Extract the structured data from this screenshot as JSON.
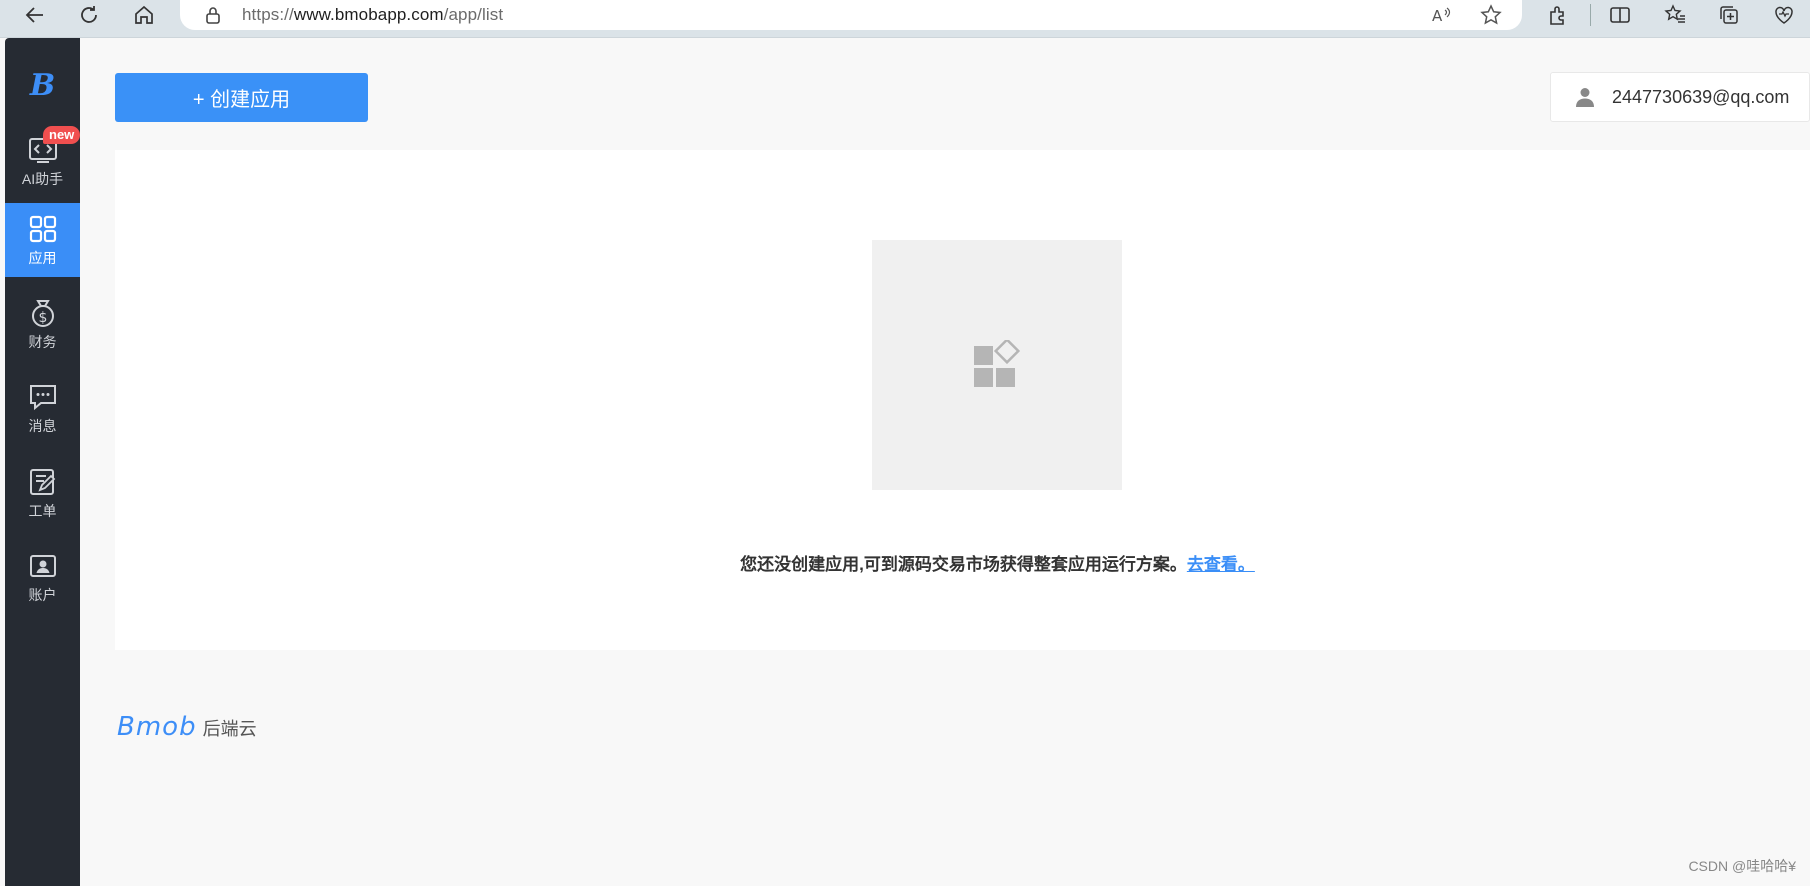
{
  "browser": {
    "url_scheme": "https://",
    "url_host": "www.bmobapp.com",
    "url_path": "/app/list",
    "icons": [
      "back-icon",
      "refresh-icon",
      "home-icon",
      "lock-icon",
      "read-aloud-icon",
      "favorite-star-icon",
      "extensions-icon",
      "split-screen-icon",
      "favorites-icon",
      "collections-icon",
      "browser-essentials-icon"
    ]
  },
  "sidebar": {
    "logo": "B",
    "items": [
      {
        "label": "AI助手",
        "icon": "ai-code-icon",
        "badge": "new"
      },
      {
        "label": "应用",
        "icon": "apps-grid-icon",
        "active": true
      },
      {
        "label": "财务",
        "icon": "money-bag-icon"
      },
      {
        "label": "消息",
        "icon": "message-icon"
      },
      {
        "label": "工单",
        "icon": "work-order-icon"
      },
      {
        "label": "账户",
        "icon": "account-icon"
      }
    ]
  },
  "header": {
    "create_button": "+ 创建应用",
    "user_email": "2447730639@qq.com"
  },
  "empty_state": {
    "message": "您还没创建应用,可到源码交易市场获得整套应用运行方案。",
    "link": "去查看。"
  },
  "footer": {
    "brand": "Bmob",
    "suffix": "后端云"
  },
  "watermark": "CSDN @哇哈哈¥",
  "colors": {
    "accent": "#3a8ef7",
    "sidebar_bg": "#262b33",
    "badge": "#f04f4f"
  }
}
